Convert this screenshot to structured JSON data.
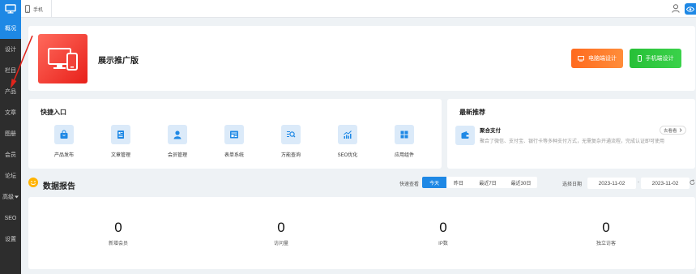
{
  "sidebar": {
    "items": [
      {
        "label": "概况",
        "active": true
      },
      {
        "label": "设计"
      },
      {
        "label": "栏目"
      },
      {
        "label": "产品"
      },
      {
        "label": "文章"
      },
      {
        "label": "图册"
      },
      {
        "label": "会员"
      },
      {
        "label": "论坛"
      },
      {
        "label": "高级"
      },
      {
        "label": "SEO"
      },
      {
        "label": "设置"
      }
    ]
  },
  "topbar": {
    "device_label": "手机"
  },
  "hero": {
    "title": "展示推广版",
    "pc_button": "电脑端设计",
    "mobile_button": "手机端设计"
  },
  "quick": {
    "title": "快捷入口",
    "items": [
      {
        "label": "产品发布"
      },
      {
        "label": "文章管理"
      },
      {
        "label": "会员管理"
      },
      {
        "label": "表单系统"
      },
      {
        "label": "万能查询"
      },
      {
        "label": "SEO优化"
      },
      {
        "label": "应用组件"
      }
    ]
  },
  "recommend": {
    "title": "最新推荐",
    "name": "聚合支付",
    "description": "聚合了微信、支付宝、银行卡等多种支付方式，无需复杂开通流程，完成认证即可使用",
    "more": "去看看"
  },
  "report": {
    "title": "数据报告",
    "quick_label": "快速查看",
    "ranges": [
      "今天",
      "昨日",
      "最近7日",
      "最近30日"
    ],
    "date_label": "选择日期",
    "start_date": "2023-11-02",
    "end_date": "2023-11-02",
    "separator": "-",
    "stats": [
      {
        "value": "0",
        "label": "新增会员"
      },
      {
        "value": "0",
        "label": "访问量"
      },
      {
        "value": "0",
        "label": "IP数"
      },
      {
        "value": "0",
        "label": "独立访客"
      }
    ]
  },
  "colors": {
    "accent": "#1e88e5",
    "sidebar_bg": "#2d2d2d",
    "pc_button": "#ff6a1e",
    "mobile_button": "#27c037",
    "hero_icon": "#e8201a",
    "annotation_arrow": "#e0241b"
  }
}
